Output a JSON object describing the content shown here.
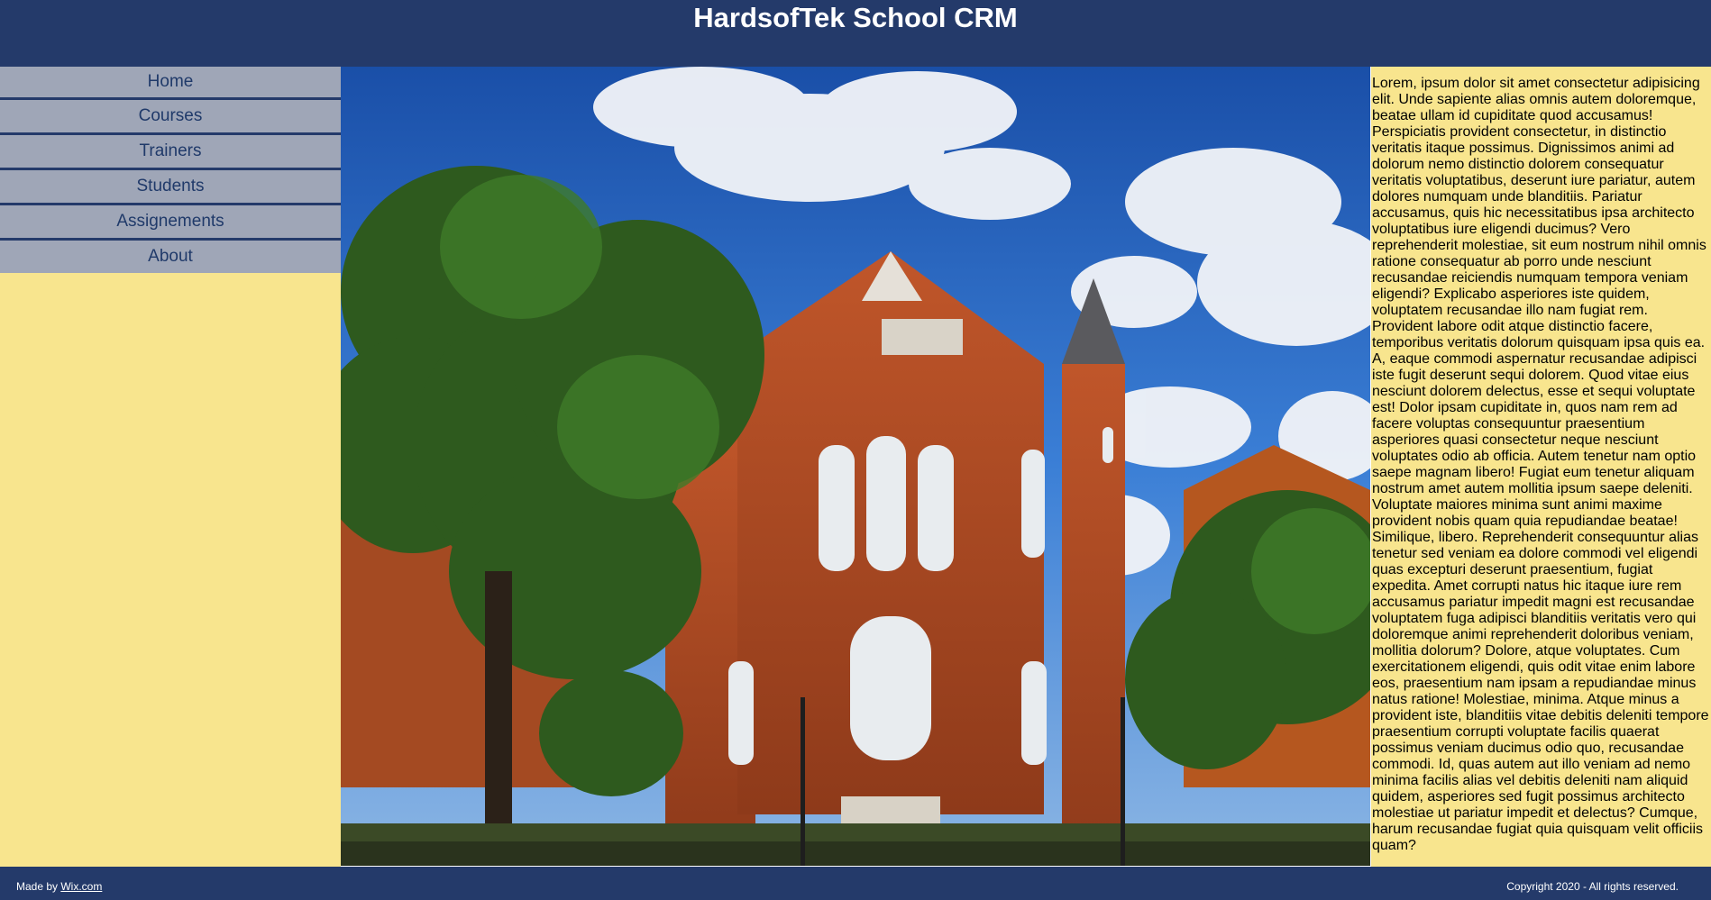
{
  "header": {
    "title": "HardsofTek School CRM"
  },
  "nav": {
    "items": [
      {
        "label": "Home"
      },
      {
        "label": "Courses"
      },
      {
        "label": "Trainers"
      },
      {
        "label": "Students"
      },
      {
        "label": "Assignements"
      },
      {
        "label": "About"
      }
    ]
  },
  "colors": {
    "header_bg": "#243a6a",
    "sidebar_bg": "#f8e58e",
    "nav_bg": "#9fa6b7",
    "nav_text": "#203a6a"
  },
  "main": {
    "text": "Lorem, ipsum dolor sit amet consectetur adipisicing elit. Unde sapiente alias omnis autem doloremque, beatae ullam id cupiditate quod accusamus! Perspiciatis provident consectetur, in distinctio veritatis itaque possimus. Dignissimos animi ad dolorum nemo distinctio dolorem consequatur veritatis voluptatibus, deserunt iure pariatur, autem dolores numquam unde blanditiis. Pariatur accusamus, quis hic necessitatibus ipsa architecto voluptatibus iure eligendi ducimus? Vero reprehenderit molestiae, sit eum nostrum nihil omnis ratione consequatur ab porro unde nesciunt recusandae reiciendis numquam tempora veniam eligendi? Explicabo asperiores iste quidem, voluptatem recusandae illo nam fugiat rem. Provident labore odit atque distinctio facere, temporibus veritatis dolorum quisquam ipsa quis ea. A, eaque commodi aspernatur recusandae adipisci iste fugit deserunt sequi dolorem. Quod vitae eius nesciunt dolorem delectus, esse et sequi voluptate est! Dolor ipsam cupiditate in, quos nam rem ad facere voluptas consequuntur praesentium asperiores quasi consectetur neque nesciunt voluptates odio ab officia. Autem tenetur nam optio saepe magnam libero! Fugiat eum tenetur aliquam nostrum amet autem mollitia ipsum saepe deleniti. Voluptate maiores minima sunt animi maxime provident nobis quam quia repudiandae beatae! Similique, libero. Reprehenderit consequuntur alias tenetur sed veniam ea dolore commodi vel eligendi quas excepturi deserunt praesentium, fugiat expedita. Amet corrupti natus hic itaque iure rem accusamus pariatur impedit magni est recusandae voluptatem fuga adipisci blanditiis veritatis vero qui doloremque animi reprehenderit doloribus veniam, mollitia dolorum? Dolore, atque voluptates. Cum exercitationem eligendi, quis odit vitae enim labore eos, praesentium nam ipsam a repudiandae minus natus ratione! Molestiae, minima. Atque minus a provident iste, blanditiis vitae debitis deleniti tempore praesentium corrupti voluptate facilis quaerat possimus veniam ducimus odio quo, recusandae commodi. Id, quas autem aut illo veniam ad nemo minima facilis alias vel debitis deleniti nam aliquid quidem, asperiores sed fugit possimus architecto molestiae ut pariatur impedit et delectus? Cumque, harum recusandae fugiat quia quisquam velit officiis quam?"
  },
  "footer": {
    "made_by": "Made by ",
    "made_by_link": "Wix.com",
    "copyright": "Copyright 2020 - All rights reserved."
  }
}
